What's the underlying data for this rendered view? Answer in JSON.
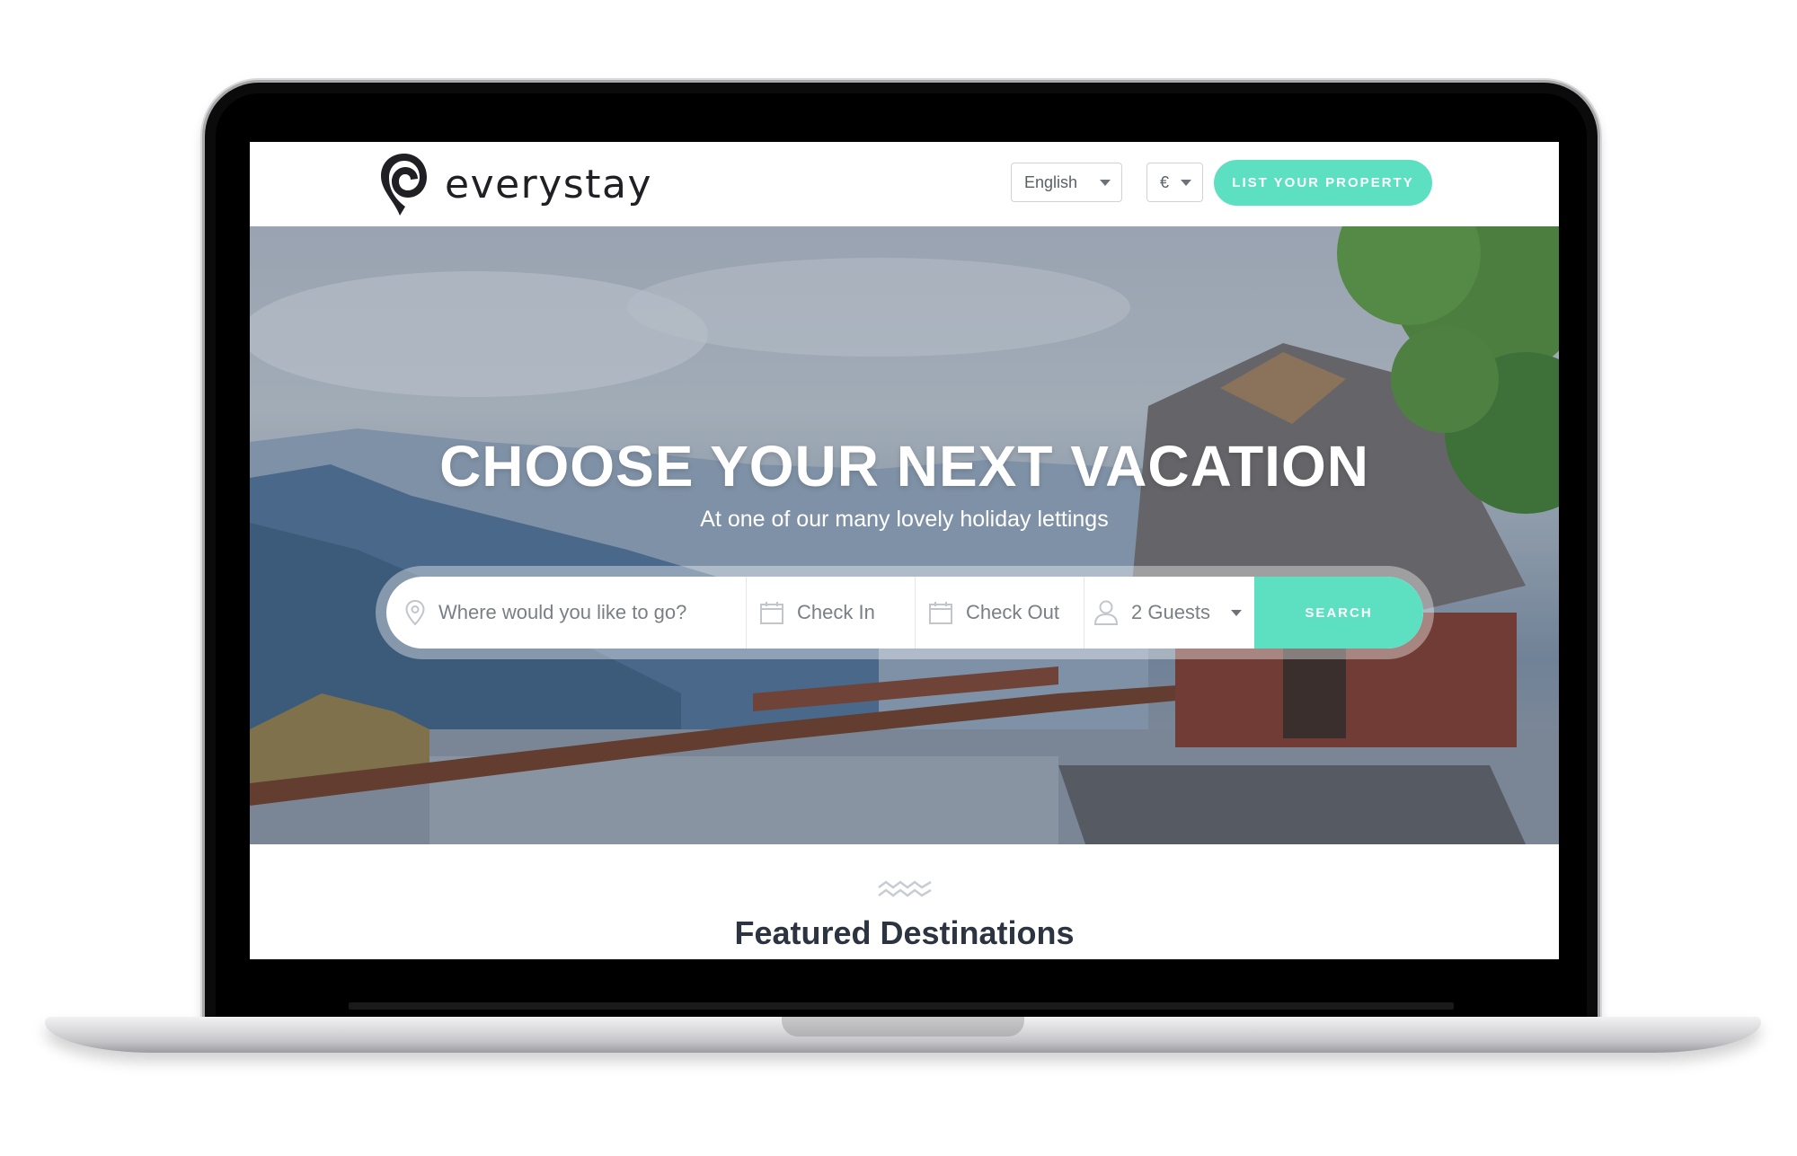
{
  "brand": {
    "name": "everystay",
    "accent_color": "#5de0c2"
  },
  "header": {
    "language": "English",
    "currency": "€",
    "list_property_label": "LIST YOUR PROPERTY"
  },
  "hero": {
    "title": "CHOOSE YOUR NEXT VACATION",
    "subtitle": "At one of our many lovely holiday lettings"
  },
  "search": {
    "where_placeholder": "Where would you like to go?",
    "check_in": "Check In",
    "check_out": "Check Out",
    "guests": "2 Guests",
    "button_label": "SEARCH"
  },
  "featured": {
    "title": "Featured Destinations"
  },
  "icons": {
    "location": "map-pin-icon",
    "calendar": "calendar-icon",
    "guests": "user-icon",
    "section_divider": "waves-icon"
  }
}
